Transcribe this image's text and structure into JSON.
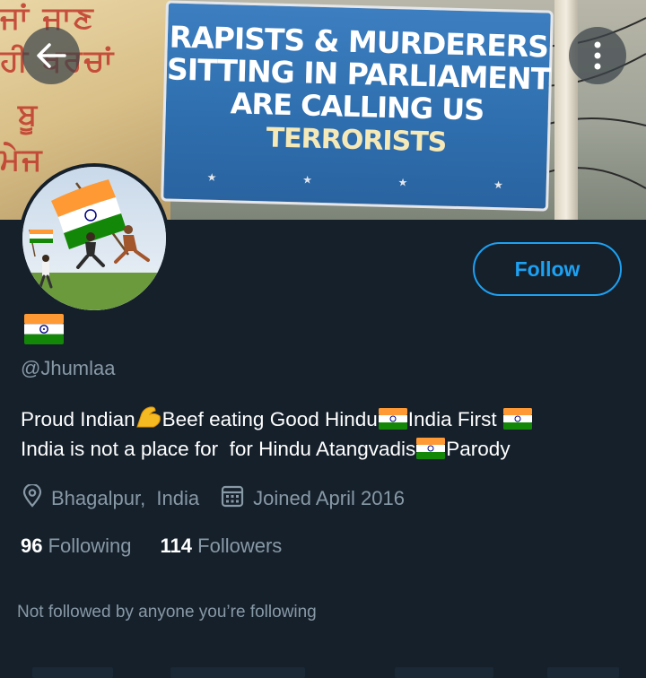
{
  "header": {
    "banner_sign": {
      "line1": "RAPISTS & MURDERERS",
      "line2": "SITTING IN PARLIAMENT",
      "line3": "ARE CALLING US",
      "line4": "TERRORISTS"
    },
    "banner_side_text": [
      "ਜਾਂ ਜਾਣ",
      "ਹੀ ਖਰਚਾਂ",
      "ਬੂ",
      "ਮੇਜ"
    ],
    "back_icon": "arrow-left-icon",
    "more_icon": "more-vertical-icon"
  },
  "profile": {
    "name_emoji": "india-flag",
    "handle": "@Jhumlaa",
    "bio": {
      "line1": {
        "part1": "Proud Indian",
        "part2": "Beef eating Good Hindu",
        "part3": "India First "
      },
      "line2": {
        "part1": "India is not a place for  for Hindu Atangvadis",
        "part2": "Parody"
      }
    },
    "location": "Bhagalpur,  India",
    "joined": "Joined April 2016",
    "following_count": "96",
    "following_label": " Following",
    "followers_count": "114",
    "followers_label": " Followers",
    "not_followed": "Not followed by anyone you’re following"
  },
  "actions": {
    "follow_label": "Follow"
  },
  "colors": {
    "background": "#15202b",
    "accent": "#1da1f2",
    "muted": "#8899a6"
  }
}
